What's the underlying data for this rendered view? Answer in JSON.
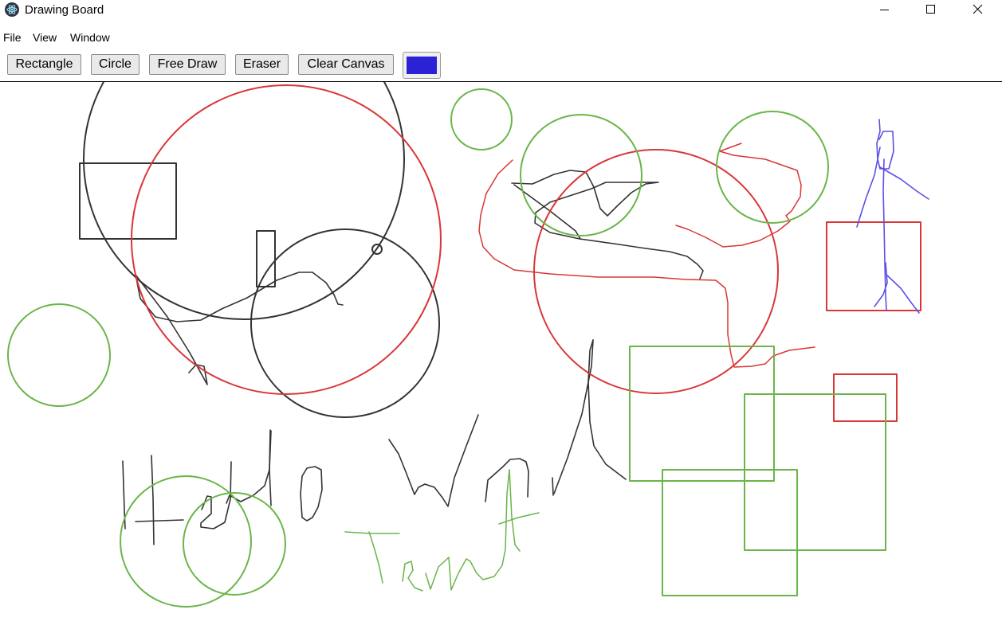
{
  "window": {
    "title": "Drawing Board",
    "app_icon": "electron-atom-icon"
  },
  "menu": {
    "items": [
      "File",
      "View",
      "Window"
    ]
  },
  "toolbar": {
    "rectangle_label": "Rectangle",
    "circle_label": "Circle",
    "freedraw_label": "Free Draw",
    "eraser_label": "Eraser",
    "clear_label": "Clear Canvas",
    "current_color": "#2b22d6"
  },
  "palette": {
    "black": "#333333",
    "red": "#d93636",
    "green": "#6ab54a",
    "blue": "#5b50e8"
  }
}
